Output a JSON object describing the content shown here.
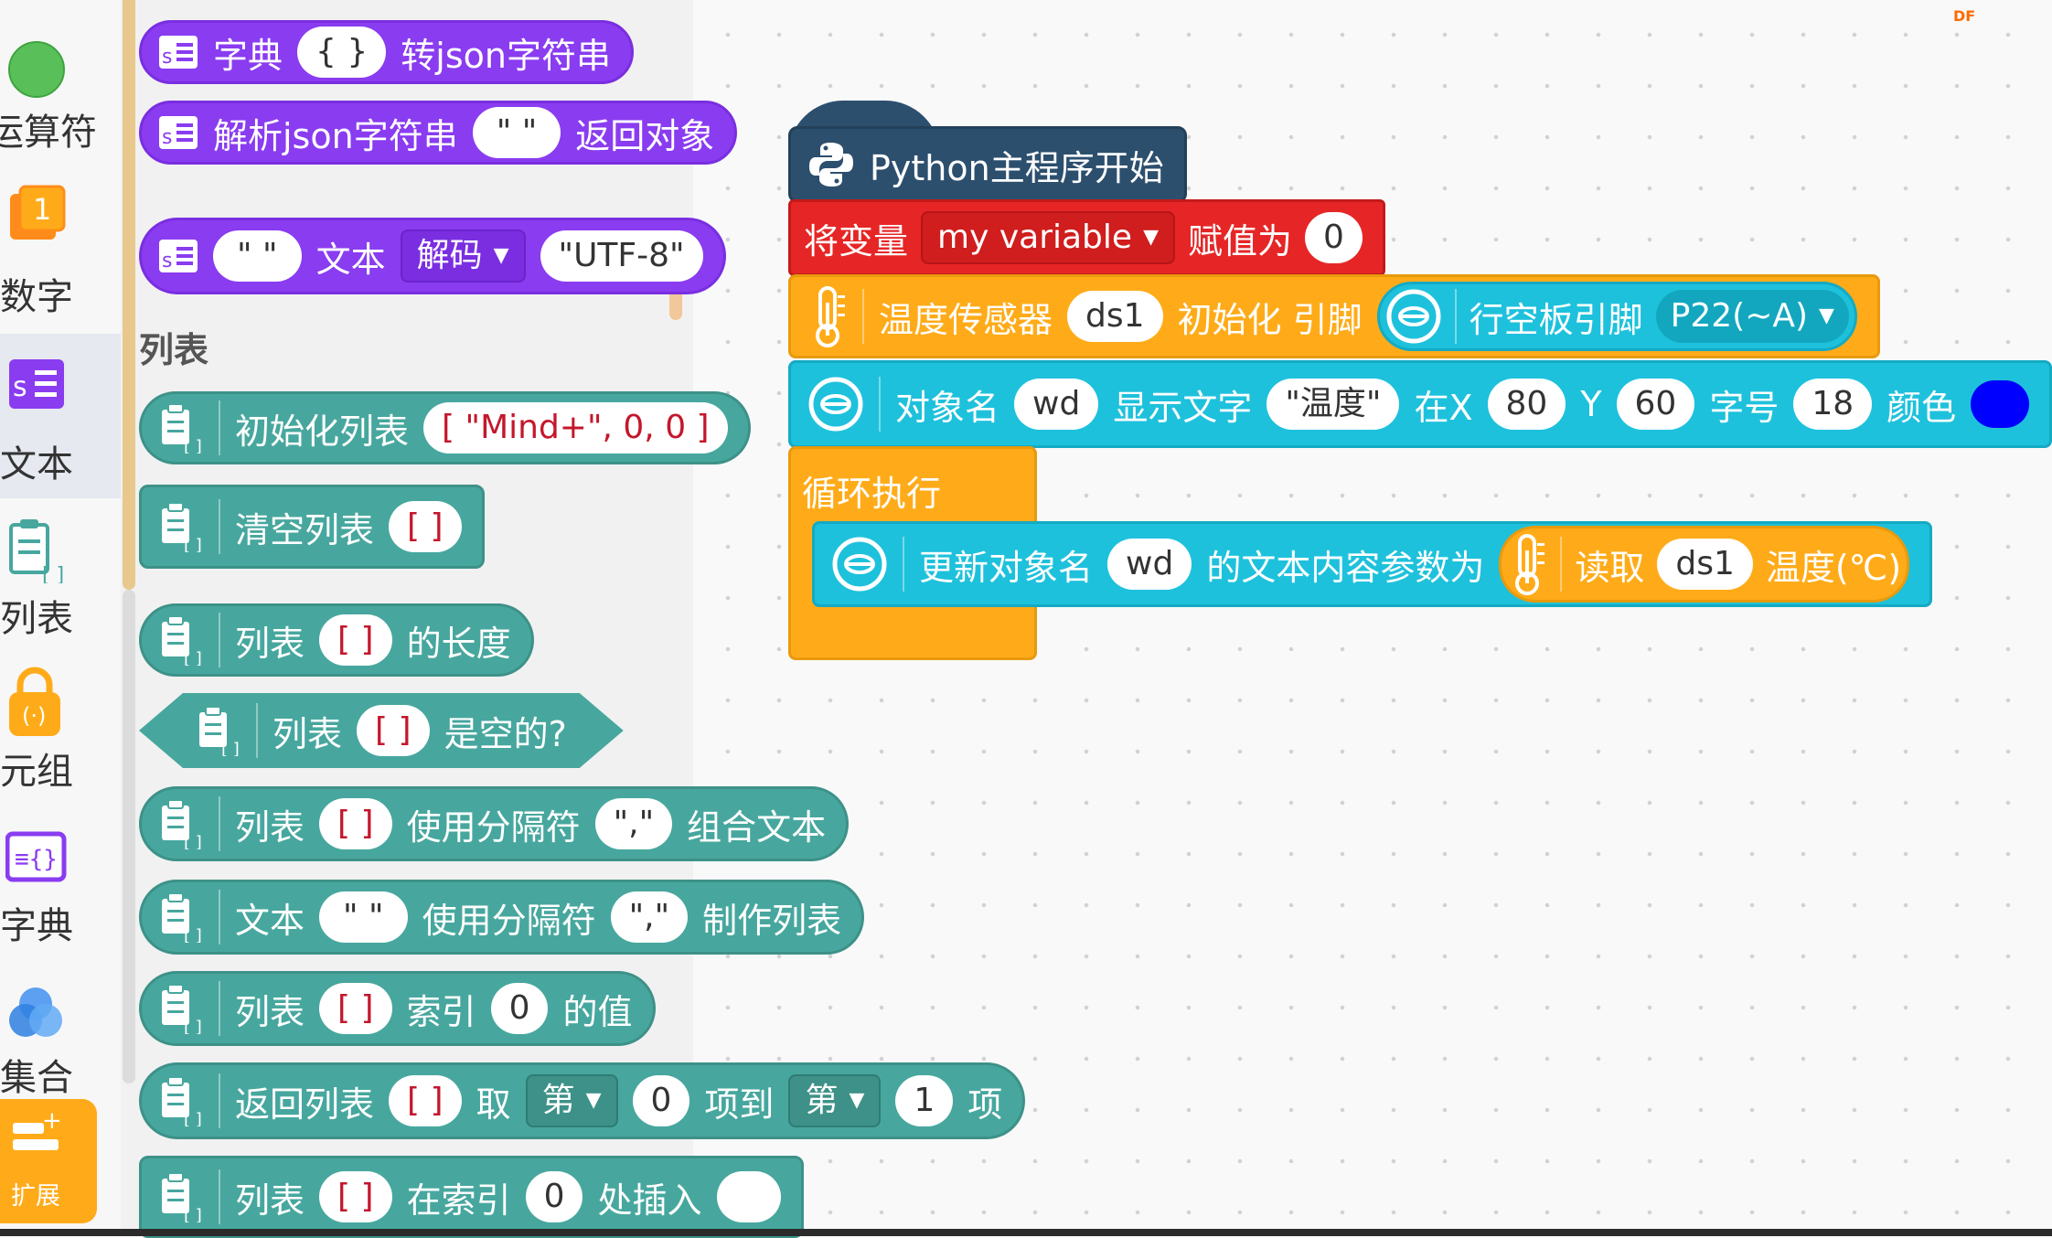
{
  "sidebar": {
    "categories": [
      {
        "label": "运算符"
      },
      {
        "label": "数字"
      },
      {
        "label": "文本"
      },
      {
        "label": "列表"
      },
      {
        "label": "元组"
      },
      {
        "label": "字典"
      },
      {
        "label": "集合"
      }
    ],
    "extension": {
      "label": "扩展"
    }
  },
  "flyout": {
    "json_block": {
      "a": "字典",
      "b": "{ }",
      "c": "转json字符串"
    },
    "parse_block": {
      "a": "解析json字符串",
      "b": "\" \"",
      "c": "返回对象"
    },
    "decode_block": {
      "a": "\" \"",
      "b": "文本",
      "c": "解码",
      "d": "\"UTF-8\""
    },
    "section_list": "列表",
    "init_list": {
      "a": "初始化列表",
      "b": "[ \"Mind+\", 0, 0 ]"
    },
    "clear_list": {
      "a": "清空列表",
      "b": "[ ]"
    },
    "list_length": {
      "a": "列表",
      "b": "[ ]",
      "c": "的长度"
    },
    "list_empty": {
      "a": "列表",
      "b": "[ ]",
      "c": "是空的?"
    },
    "list_join": {
      "a": "列表",
      "b": "[ ]",
      "c": "使用分隔符",
      "d": "\",\"",
      "e": "组合文本"
    },
    "text_split": {
      "a": "文本",
      "b": "\" \"",
      "c": "使用分隔符",
      "d": "\",\"",
      "e": "制作列表"
    },
    "list_index": {
      "a": "列表",
      "b": "[ ]",
      "c": "索引",
      "d": "0",
      "e": "的值"
    },
    "list_slice": {
      "a": "返回列表",
      "b": "[ ]",
      "c": "取",
      "d": "第",
      "e": "0",
      "f": "项到",
      "g": "第",
      "h": "1",
      "i": "项"
    },
    "list_insert": {
      "a": "列表",
      "b": "[ ]",
      "c": "在索引",
      "d": "0",
      "e": "处插入",
      "f": ""
    }
  },
  "workspace": {
    "hat": "Python主程序开始",
    "set_var": {
      "a": "将变量",
      "var": "my variable",
      "b": "赋值为",
      "val": "0"
    },
    "sensor_init": {
      "a": "温度传感器",
      "name": "ds1",
      "b": "初始化 引脚",
      "c": "行空板引脚",
      "pin": "P22(~A)"
    },
    "display_text": {
      "a": "对象名",
      "obj": "wd",
      "b": "显示文字",
      "text": "\"温度\"",
      "c": "在X",
      "x": "80",
      "d": "Y",
      "y": "60",
      "e": "字号",
      "size": "18",
      "f": "颜色",
      "color": "#0000ff"
    },
    "loop": "循环执行",
    "update": {
      "a": "更新对象名",
      "obj": "wd",
      "b": "的文本内容参数为",
      "c": "读取",
      "sensor": "ds1",
      "d": "温度(℃)"
    }
  },
  "watermark": "DF"
}
